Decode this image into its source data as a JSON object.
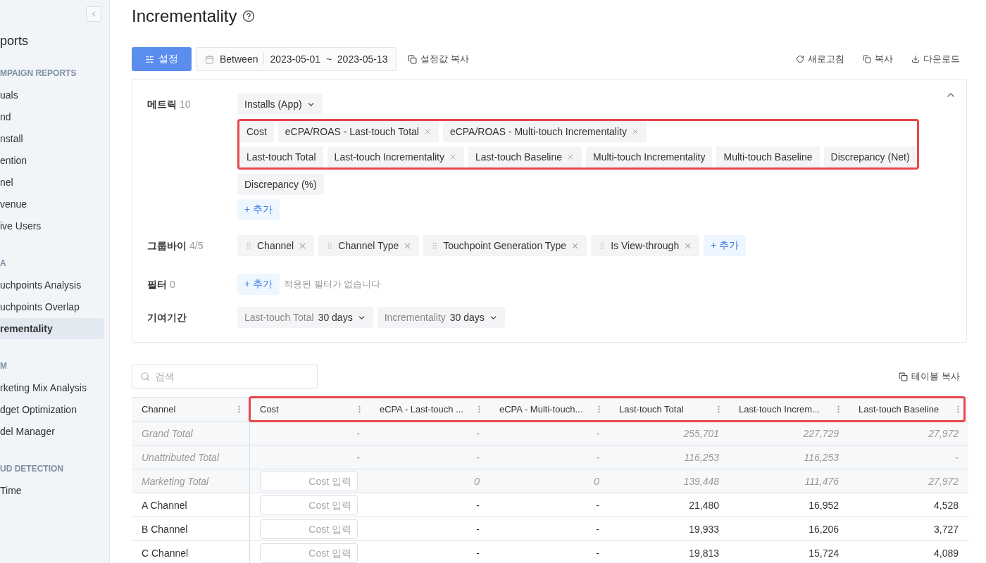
{
  "sidebar": {
    "title": "ports",
    "sections": [
      {
        "heading": "MPAIGN REPORTS",
        "items": [
          {
            "label": "uals",
            "selected": false
          },
          {
            "label": "nd",
            "selected": false
          },
          {
            "label": "nstall",
            "selected": false
          },
          {
            "label": "ention",
            "selected": false
          },
          {
            "label": "nel",
            "selected": false
          },
          {
            "label": "venue",
            "selected": false
          },
          {
            "label": "ive Users",
            "selected": false
          }
        ]
      },
      {
        "heading": "A",
        "items": [
          {
            "label": "uchpoints Analysis",
            "selected": false
          },
          {
            "label": "uchpoints Overlap",
            "selected": false
          },
          {
            "label": "rementality",
            "selected": true
          }
        ]
      },
      {
        "heading": "M",
        "items": [
          {
            "label": "rketing Mix Analysis",
            "selected": false
          },
          {
            "label": "dget Optimization",
            "selected": false
          },
          {
            "label": "del Manager",
            "selected": false
          }
        ]
      },
      {
        "heading": "UD DETECTION",
        "items": [
          {
            "label": "Time",
            "selected": false
          }
        ]
      }
    ]
  },
  "page": {
    "title": "Incrementality"
  },
  "toolbar": {
    "settings_button": "설정",
    "date_range": {
      "mode": "Between",
      "range": "2023-05-01  ~  2023-05-13"
    },
    "copy_settings": "설정값 복사",
    "actions": [
      "새로고침",
      "복사",
      "다운로드"
    ]
  },
  "settings": {
    "expanded": true,
    "metrics": {
      "label": "메트릭",
      "count": "10",
      "event": "Installs (App)",
      "highlighted_rows": [
        [
          {
            "label": "Cost",
            "removable": false
          },
          {
            "label": "eCPA/ROAS - Last-touch Total",
            "removable": true
          },
          {
            "label": "eCPA/ROAS - Multi-touch Incrementality",
            "removable": true
          }
        ],
        [
          {
            "label": "Last-touch Total",
            "removable": false
          },
          {
            "label": "Last-touch Incrementality",
            "removable": true
          },
          {
            "label": "Last-touch Baseline",
            "removable": true
          },
          {
            "label": "Multi-touch Incrementality",
            "removable": false
          },
          {
            "label": "Multi-touch Baseline",
            "removable": false
          },
          {
            "label": "Discrepancy (Net)",
            "removable": false
          }
        ]
      ],
      "chips": [
        {
          "label": "Discrepancy (%)",
          "removable": false
        }
      ],
      "add": "+ 추가"
    },
    "group_by": {
      "label": "그룹바이",
      "count": "4/5",
      "chips": [
        "Channel",
        "Channel Type",
        "Touchpoint Generation Type",
        "Is View-through"
      ],
      "add": "+ 추가"
    },
    "filter": {
      "label": "필터",
      "count": "0",
      "add": "+ 추가",
      "empty": "적용된 필터가 없습니다"
    },
    "attribution": {
      "label": "기여기간",
      "windows": [
        {
          "name": "Last-touch Total",
          "value": "30 days"
        },
        {
          "name": "Incrementality",
          "value": "30 days"
        }
      ]
    }
  },
  "table_tools": {
    "search": {
      "placeholder": "검색"
    },
    "copy": "테이블 복사"
  },
  "table": {
    "columns": [
      "Channel",
      "Cost",
      "eCPA - Last-touch ...",
      "eCPA - Multi-touch...",
      "Last-touch Total",
      "Last-touch Increm...",
      "Last-touch Baseline"
    ],
    "rows": [
      {
        "kind": "total",
        "label": "Grand Total",
        "cells": [
          {
            "kind": "text",
            "text": "-"
          },
          {
            "kind": "text",
            "text": "-"
          },
          {
            "kind": "text",
            "text": "-"
          },
          {
            "kind": "text",
            "text": "255,701"
          },
          {
            "kind": "text",
            "text": "227,729"
          },
          {
            "kind": "text",
            "text": "27,972"
          }
        ]
      },
      {
        "kind": "total",
        "label": "Unattributed Total",
        "cells": [
          {
            "kind": "text",
            "text": "-"
          },
          {
            "kind": "text",
            "text": "-"
          },
          {
            "kind": "text",
            "text": "-"
          },
          {
            "kind": "text",
            "text": "116,253"
          },
          {
            "kind": "text",
            "text": "116,253"
          },
          {
            "kind": "text",
            "text": "-"
          }
        ]
      },
      {
        "kind": "total",
        "label": "Marketing Total",
        "cells": [
          {
            "kind": "input",
            "placeholder": "Cost 입력"
          },
          {
            "kind": "text",
            "text": "0"
          },
          {
            "kind": "text",
            "text": "0"
          },
          {
            "kind": "text",
            "text": "139,448"
          },
          {
            "kind": "text",
            "text": "111,476"
          },
          {
            "kind": "text",
            "text": "27,972"
          }
        ]
      },
      {
        "kind": "channel",
        "label": "A Channel",
        "cells": [
          {
            "kind": "input",
            "placeholder": "Cost 입력"
          },
          {
            "kind": "text",
            "text": "-"
          },
          {
            "kind": "text",
            "text": "-"
          },
          {
            "kind": "text",
            "text": "21,480"
          },
          {
            "kind": "text",
            "text": "16,952"
          },
          {
            "kind": "text",
            "text": "4,528"
          }
        ]
      },
      {
        "kind": "channel",
        "label": "B Channel",
        "cells": [
          {
            "kind": "input",
            "placeholder": "Cost 입력"
          },
          {
            "kind": "text",
            "text": "-"
          },
          {
            "kind": "text",
            "text": "-"
          },
          {
            "kind": "text",
            "text": "19,933"
          },
          {
            "kind": "text",
            "text": "16,206"
          },
          {
            "kind": "text",
            "text": "3,727"
          }
        ]
      },
      {
        "kind": "channel",
        "label": "C Channel",
        "cells": [
          {
            "kind": "input",
            "placeholder": "Cost 입력"
          },
          {
            "kind": "text",
            "text": "-"
          },
          {
            "kind": "text",
            "text": "-"
          },
          {
            "kind": "text",
            "text": "19,813"
          },
          {
            "kind": "text",
            "text": "15,724"
          },
          {
            "kind": "text",
            "text": "4,089"
          }
        ]
      }
    ],
    "header_highlighted": true
  }
}
